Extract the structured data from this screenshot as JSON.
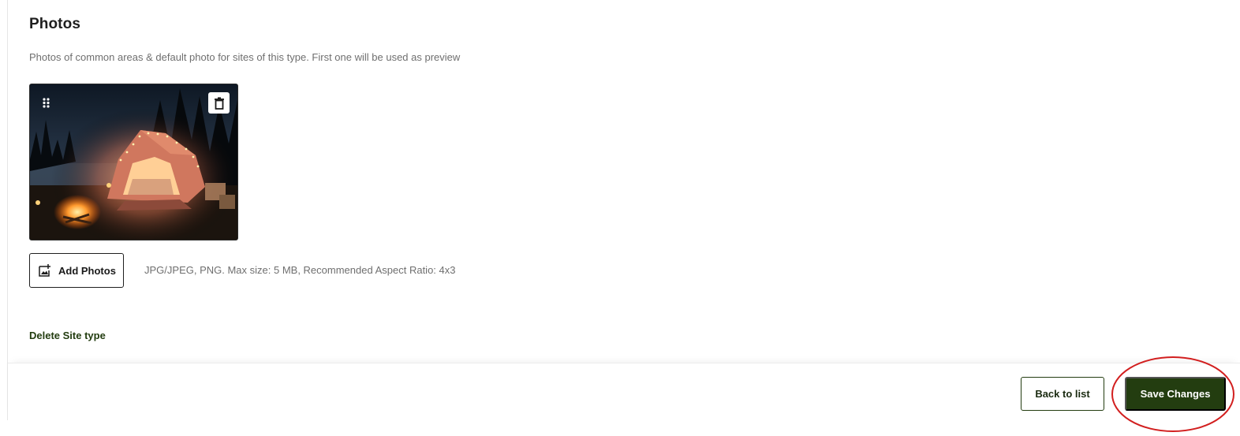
{
  "photos_section": {
    "title": "Photos",
    "description": "Photos of common areas & default photo for sites of this type. First one will be used as preview",
    "photos": [
      {
        "icon_drag": "drag-handle-icon",
        "icon_delete": "trash-icon"
      }
    ],
    "add_photos_label": "Add Photos",
    "upload_hint": "JPG/JPEG, PNG. Max size: 5 MB, Recommended Aspect Ratio: 4x3"
  },
  "delete_site_type_label": "Delete Site type",
  "footer": {
    "back_label": "Back to list",
    "save_label": "Save Changes"
  },
  "colors": {
    "primary": "#233d10",
    "highlight_ring": "#d21f1f",
    "muted_text": "#6f6f6f"
  }
}
